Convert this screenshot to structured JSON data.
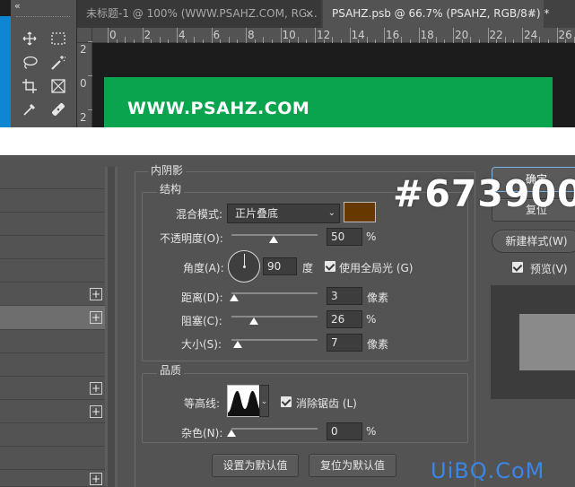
{
  "tabs": {
    "tab1": "未标题-1 @ 100% (WWW.PSAHZ.COM, RG...",
    "tab2": "PSAHZ.psb @ 66.7% (PSAHZ, RGB/8#) *",
    "close": "×"
  },
  "toolbar": {
    "collapse": "«"
  },
  "ruler": {
    "h_numbers": [
      "0",
      "2",
      "4",
      "6",
      "8",
      "10",
      "12",
      "14",
      "16",
      "18",
      "20",
      "22",
      "24",
      "26"
    ],
    "v_numbers": [
      "2",
      "0",
      "2"
    ]
  },
  "canvas": {
    "text": "WWW.PSAHZ.COM",
    "color": "#0aa44f"
  },
  "dialog": {
    "section_title": "内阴影",
    "structure": {
      "title": "结构",
      "blend_mode_label": "混合模式:",
      "blend_mode_value": "正片叠底",
      "color": "#673900",
      "opacity_label": "不透明度(O):",
      "opacity_value": "50",
      "opacity_unit": "%",
      "angle_label": "角度(A):",
      "angle_value": "90",
      "angle_unit": "度",
      "global_light_label": "使用全局光 (G)",
      "global_light_checked": true,
      "distance_label": "距离(D):",
      "distance_value": "3",
      "distance_unit": "像素",
      "choke_label": "阻塞(C):",
      "choke_value": "26",
      "choke_unit": "%",
      "size_label": "大小(S):",
      "size_value": "7",
      "size_unit": "像素"
    },
    "quality": {
      "title": "品质",
      "contour_label": "等高线:",
      "antialias_label": "消除锯齿 (L)",
      "antialias_checked": true,
      "noise_label": "杂色(N):",
      "noise_value": "0",
      "noise_unit": "%"
    },
    "buttons": {
      "make_default": "设置为默认值",
      "reset_default": "复位为默认值",
      "ok": "确定",
      "cancel": "复位",
      "new_style": "新建样式(W)",
      "preview_label": "预览(V)",
      "preview_checked": true
    }
  },
  "overlay": {
    "hex": "#673900"
  },
  "watermark": "UiBQ.CoM"
}
